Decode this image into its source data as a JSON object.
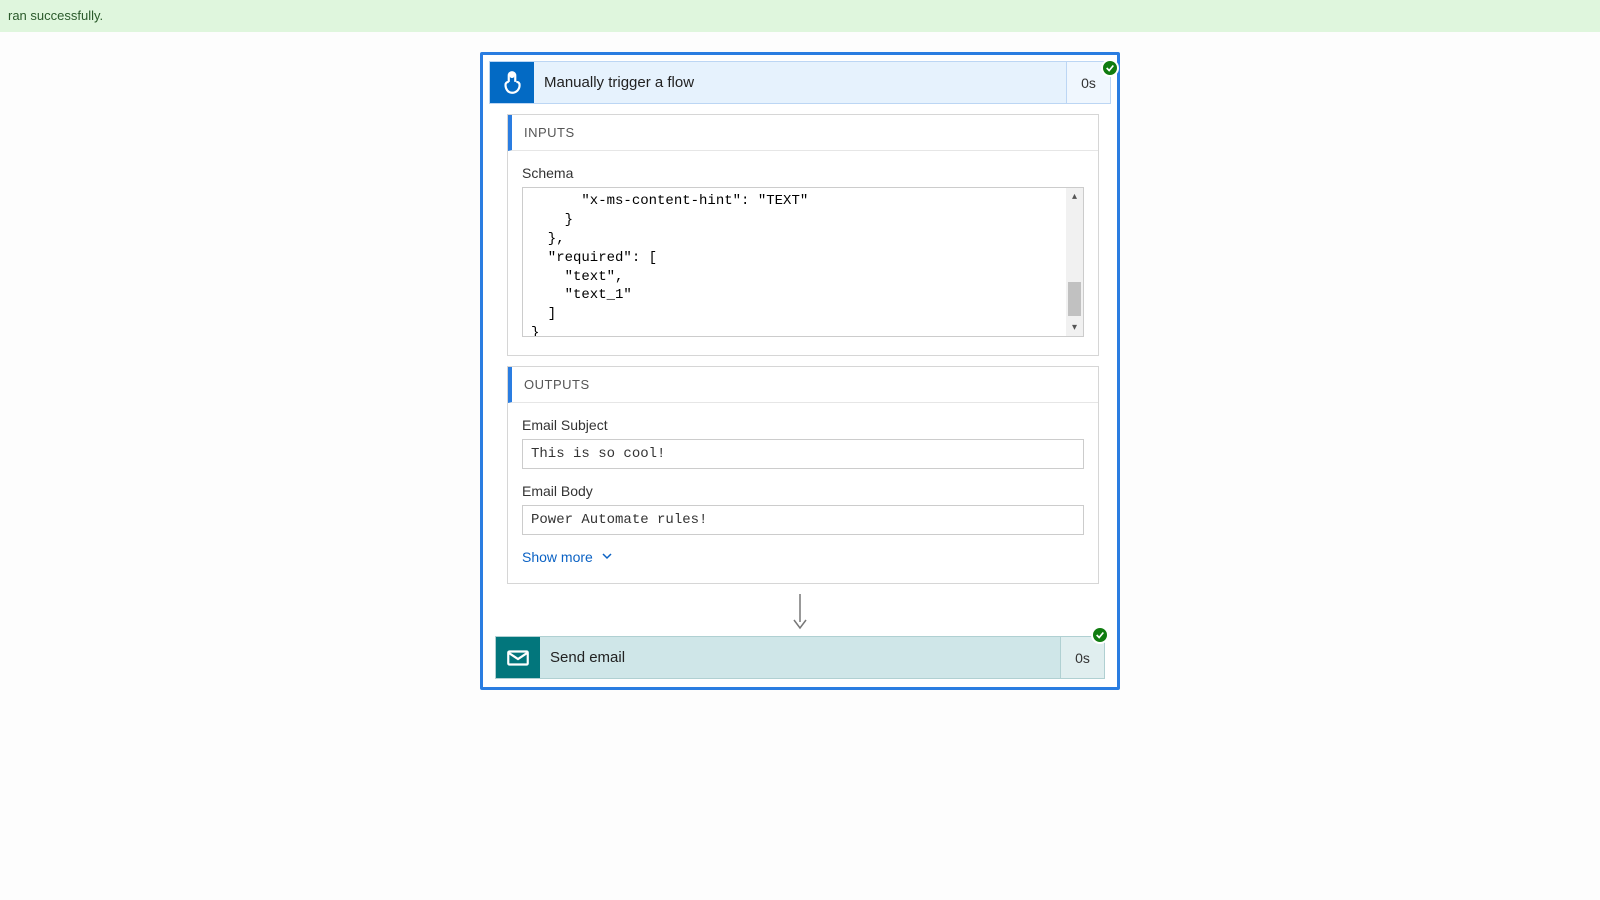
{
  "success_bar": "ran successfully.",
  "trigger": {
    "title": "Manually trigger a flow",
    "duration": "0s"
  },
  "inputs": {
    "header": "INPUTS",
    "schema_label": "Schema",
    "schema_text": "      \"x-ms-content-hint\": \"TEXT\"\n    }\n  },\n  \"required\": [\n    \"text\",\n    \"text_1\"\n  ]\n}"
  },
  "outputs": {
    "header": "OUTPUTS",
    "fields": [
      {
        "label": "Email Subject",
        "value": "This is so cool!"
      },
      {
        "label": "Email Body",
        "value": "Power Automate rules!"
      }
    ],
    "show_more": "Show more"
  },
  "send": {
    "title": "Send email",
    "duration": "0s"
  }
}
